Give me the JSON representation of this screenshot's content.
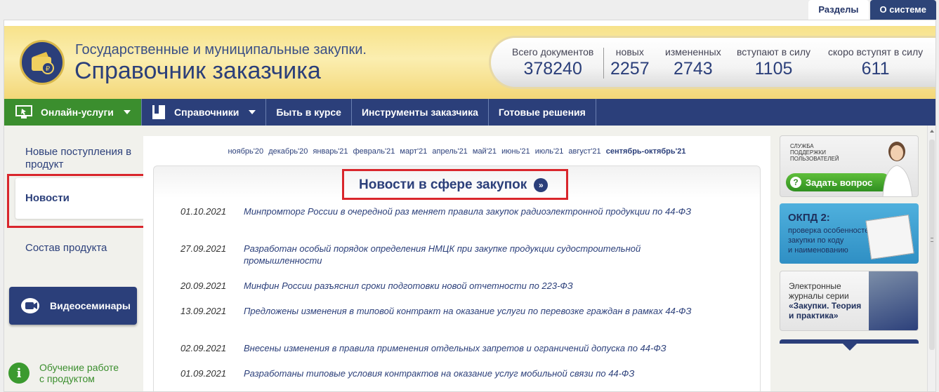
{
  "top_tabs": {
    "sections": "Разделы",
    "about": "О системе"
  },
  "header": {
    "subtitle": "Государственные и муниципальные закупки.",
    "title": "Справочник заказчика",
    "stats": [
      {
        "label": "Всего документов",
        "value": "378240"
      },
      {
        "label": "новых",
        "value": "2257"
      },
      {
        "label": "измененных",
        "value": "2743"
      },
      {
        "label": "вступают в силу",
        "value": "1105"
      },
      {
        "label": "скоро вступят в силу",
        "value": "611"
      }
    ]
  },
  "nav": {
    "online": "Онлайн-услуги",
    "directories": "Справочники",
    "news": "Быть в курсе",
    "tools": "Инструменты заказчика",
    "solutions": "Готовые решения"
  },
  "sidebar": {
    "new_arrivals": "Новые поступления в продукт",
    "news": "Новости",
    "composition": "Состав продукта",
    "video": "Видеосеминары",
    "learn_line1": "Обучение работе",
    "learn_line2": "с продуктом"
  },
  "months": [
    "ноябрь'20",
    "декабрь'20",
    "январь'21",
    "февраль'21",
    "март'21",
    "апрель'21",
    "май'21",
    "июнь'21",
    "июль'21",
    "август'21",
    "сентябрь-октябрь'21"
  ],
  "news": {
    "title": "Новости в сфере закупок",
    "more_glyph": "»",
    "items": [
      {
        "date": "01.10.2021",
        "text": "Минпромторг России в очередной раз меняет правила закупок радиоэлектронной продукции по 44-ФЗ"
      },
      {
        "date": "27.09.2021",
        "text": "Разработан особый порядок определения НМЦК при закупке продукции судостроительной промышленности"
      },
      {
        "date": "20.09.2021",
        "text": "Минфин России разъяснил сроки подготовки новой отчетности по 223-ФЗ"
      },
      {
        "date": "13.09.2021",
        "text": "Предложены изменения в типовой контракт на оказание услуги по перевозке граждан в рамках 44-ФЗ"
      },
      {
        "date": "02.09.2021",
        "text": "Внесены изменения в правила применения отдельных запретов и ограничений допуска по 44-ФЗ"
      },
      {
        "date": "01.09.2021",
        "text": "Разработаны типовые условия контрактов на оказание услуг мобильной связи по 44-ФЗ"
      }
    ]
  },
  "banners": {
    "support_line1": "Служба",
    "support_line2": "поддержки",
    "support_line3": "пользователей",
    "ask": "Задать вопрос",
    "okpd_title": "ОКПД 2:",
    "okpd_line1": "проверка особенностей",
    "okpd_line2": "закупки по коду",
    "okpd_line3": "и наименованию",
    "journal_line1": "Электронные",
    "journal_line2": "журналы серии",
    "journal_line3": "«Закупки. Теория",
    "journal_line4": "и практика»"
  },
  "colors": {
    "brand_blue": "#2b3f7a",
    "green": "#3b8e2e",
    "highlight_red": "#d9262c"
  }
}
